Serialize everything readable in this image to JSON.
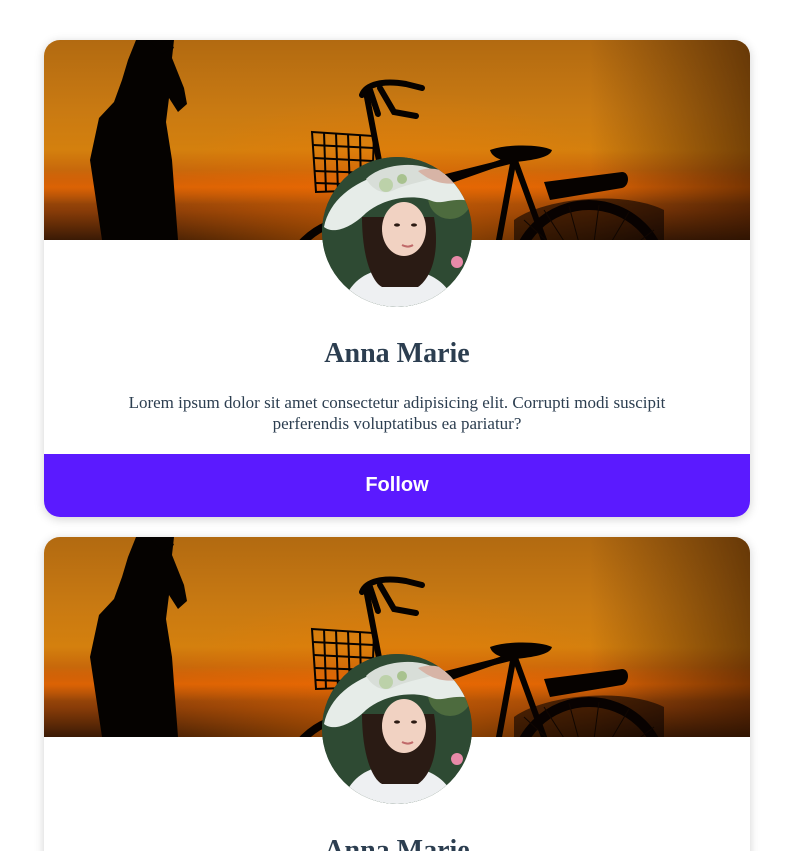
{
  "cards": [
    {
      "name": "Anna Marie",
      "bio": "Lorem ipsum dolor sit amet consectetur adipisicing elit. Corrupti modi suscipit perferendis voluptatibus ea pariatur?",
      "follow_label": "Follow"
    },
    {
      "name": "Anna Marie"
    }
  ],
  "colors": {
    "accent": "#5b1aff",
    "text": "#2c3e50",
    "background": "#ffffff"
  },
  "icons": [
    "cover-image",
    "avatar-image"
  ]
}
